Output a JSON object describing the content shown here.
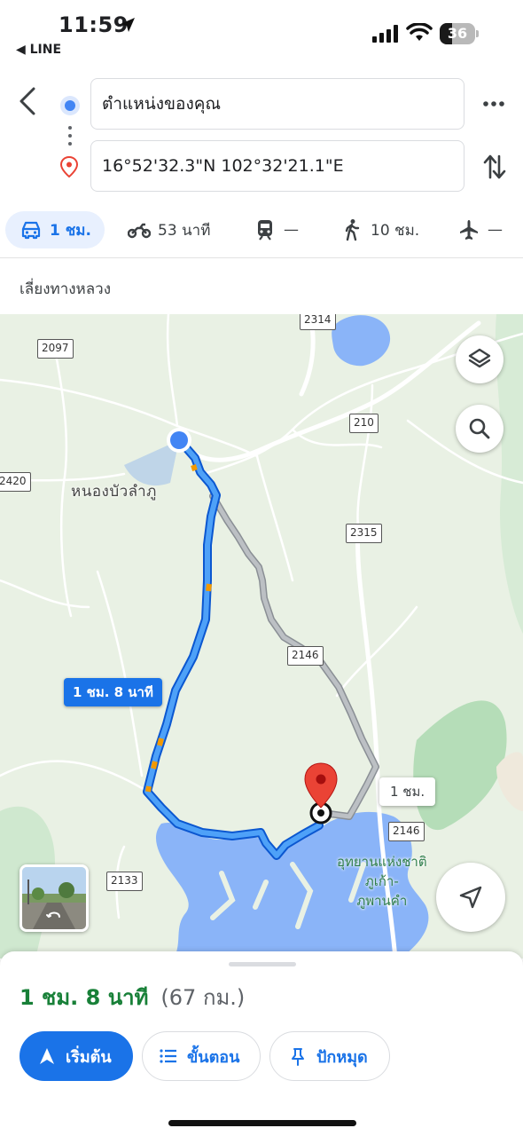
{
  "status_bar": {
    "time": "11:59",
    "back_app": "◀ LINE",
    "battery": "36",
    "battery_level_percent": 36
  },
  "route": {
    "origin": "ตำแหน่งของคุณ",
    "destination": "16°52'32.3\"N 102°32'21.1\"E"
  },
  "modes": [
    {
      "name": "car",
      "label": "1 ชม.",
      "active": true
    },
    {
      "name": "motorcycle",
      "label": "53 นาที"
    },
    {
      "name": "transit",
      "label": "—"
    },
    {
      "name": "walk",
      "label": "10 ชม."
    },
    {
      "name": "flight",
      "label": "—"
    }
  ],
  "option_note": "เลี่ยงทางหลวง",
  "map": {
    "road_shields": [
      "2314",
      "2097",
      "210",
      "2420",
      "2315",
      "2146",
      "2146",
      "2133"
    ],
    "place_label": "หนองบัวลำภู",
    "park_label": [
      "อุทยานแห่งชาติ",
      "ภูเก้า-",
      "ภูพานคำ"
    ],
    "route_badge": "1 ชม. 8 นาที",
    "alt_badge": "1 ชม."
  },
  "summary": {
    "duration": "1 ชม. 8 นาที",
    "distance": "(67 กม.)"
  },
  "actions": {
    "start": "เริ่มต้น",
    "steps": "ขั้นตอน",
    "pin": "ปักหมุด"
  },
  "colors": {
    "accent": "#1a73e8",
    "duration": "#188038",
    "route": "#1a73e8",
    "alt_route": "#9aa0a6",
    "water": "#8ab4f8"
  }
}
